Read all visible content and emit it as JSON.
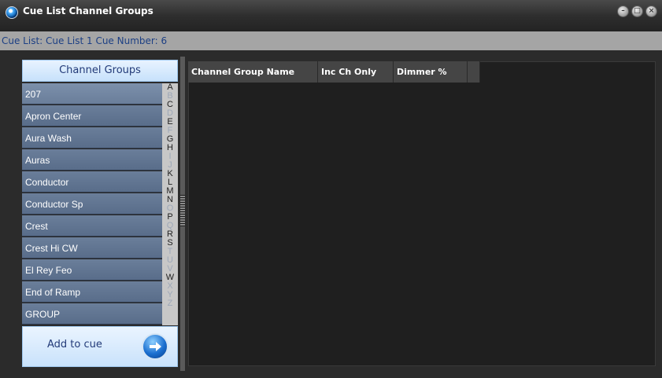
{
  "window": {
    "title": "Cue List Channel Groups",
    "controls": [
      "minimize",
      "maximize",
      "close"
    ]
  },
  "subheader": {
    "text": "Cue List: Cue List 1 Cue Number: 6"
  },
  "channel_groups": {
    "header": "Channel Groups",
    "items": [
      "207",
      "Apron Center",
      "Aura Wash",
      "Auras",
      "Conductor",
      "Conductor Sp",
      "Crest",
      "Crest Hi CW",
      "El Rey Feo",
      "End of Ramp",
      "GROUP"
    ],
    "selected_index": 0
  },
  "alphabet": {
    "letters": [
      {
        "l": "A",
        "active": true
      },
      {
        "l": "B",
        "active": false
      },
      {
        "l": "C",
        "active": true
      },
      {
        "l": "D",
        "active": false
      },
      {
        "l": "E",
        "active": true
      },
      {
        "l": "F",
        "active": false
      },
      {
        "l": "G",
        "active": true
      },
      {
        "l": "H",
        "active": true
      },
      {
        "l": "I",
        "active": false
      },
      {
        "l": "J",
        "active": false
      },
      {
        "l": "K",
        "active": true
      },
      {
        "l": "L",
        "active": true
      },
      {
        "l": "M",
        "active": true
      },
      {
        "l": "N",
        "active": true
      },
      {
        "l": "O",
        "active": false
      },
      {
        "l": "P",
        "active": true
      },
      {
        "l": "Q",
        "active": false
      },
      {
        "l": "R",
        "active": true
      },
      {
        "l": "S",
        "active": true
      },
      {
        "l": "T",
        "active": false
      },
      {
        "l": "U",
        "active": false
      },
      {
        "l": "V",
        "active": false
      },
      {
        "l": "W",
        "active": true
      },
      {
        "l": "X",
        "active": false
      },
      {
        "l": "Y",
        "active": false
      },
      {
        "l": "Z",
        "active": false
      }
    ]
  },
  "add_button": {
    "label": "Add to cue",
    "icon": "arrow-right-icon"
  },
  "grid": {
    "columns": [
      "Channel Group Name",
      "Inc Ch Only",
      "Dimmer %",
      ""
    ],
    "rows": []
  },
  "colors": {
    "accent": "#1b6fd0",
    "list_item": "#5f7390",
    "header_bg": "#c7e1fb",
    "subheader_text": "#1c3f84"
  }
}
